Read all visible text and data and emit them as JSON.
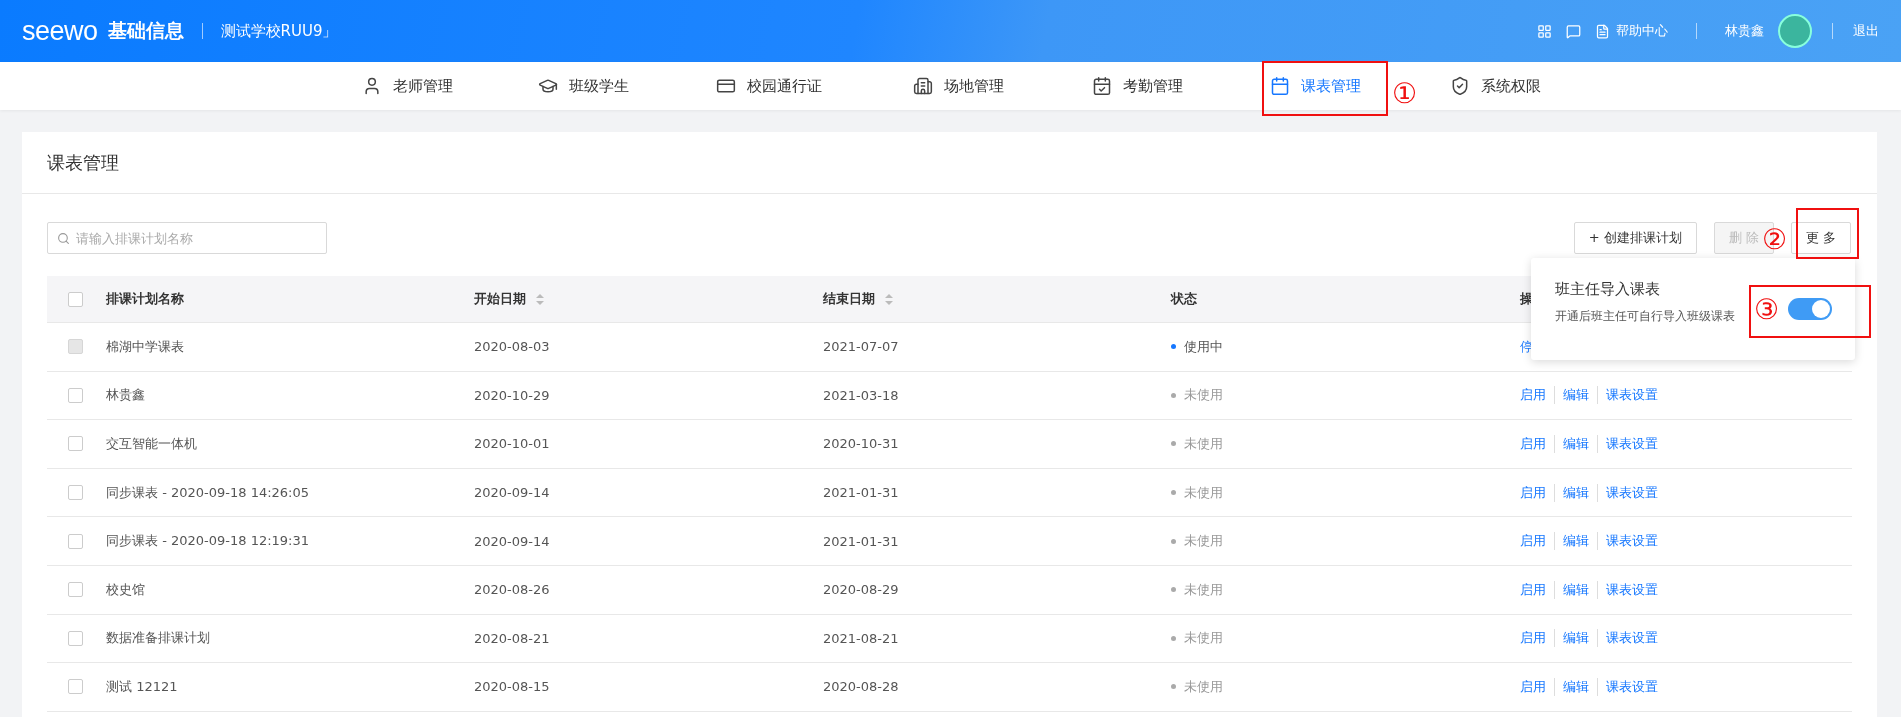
{
  "header": {
    "logo": "seewo",
    "app_name": "基础信息",
    "school": "测试学校RUU9」",
    "help": "帮助中心",
    "user": "林贵鑫",
    "logout": "退出"
  },
  "nav": [
    {
      "label": "老师管理",
      "selected": false
    },
    {
      "label": "班级学生",
      "selected": false
    },
    {
      "label": "校园通行证",
      "selected": false
    },
    {
      "label": "场地管理",
      "selected": false
    },
    {
      "label": "考勤管理",
      "selected": false
    },
    {
      "label": "课表管理",
      "selected": true
    },
    {
      "label": "系统权限",
      "selected": false
    }
  ],
  "card": {
    "title": "课表管理",
    "search": {
      "placeholder": "请输入排课计划名称"
    },
    "buttons": [
      {
        "label": "+ 创建排课计划",
        "disabled": false
      },
      {
        "label": "删 除",
        "disabled": true
      },
      {
        "label": "更 多",
        "disabled": false
      }
    ]
  },
  "table": {
    "select_all": {
      "checked": false
    },
    "columns": [
      {
        "label": "排课计划名称",
        "sortable": false
      },
      {
        "label": "开始日期",
        "sortable": true
      },
      {
        "label": "结束日期",
        "sortable": true
      },
      {
        "label": "状态",
        "sortable": false
      },
      {
        "label": "操",
        "sortable": false
      }
    ],
    "rows": [
      {
        "checkbox_disabled": true,
        "name": "棉湖中学课表",
        "start": "2020-08-03",
        "end": "2021-07-07",
        "status": {
          "text": "使用中",
          "kind": "active"
        },
        "actions": [
          "停"
        ]
      },
      {
        "checkbox_disabled": false,
        "name": "林贵鑫",
        "start": "2020-10-29",
        "end": "2021-03-18",
        "status": {
          "text": "未使用",
          "kind": "inactive"
        },
        "actions": [
          "启用",
          "编辑",
          "课表设置"
        ]
      },
      {
        "checkbox_disabled": false,
        "name": "交互智能一体机",
        "start": "2020-10-01",
        "end": "2020-10-31",
        "status": {
          "text": "未使用",
          "kind": "inactive"
        },
        "actions": [
          "启用",
          "编辑",
          "课表设置"
        ]
      },
      {
        "checkbox_disabled": false,
        "name": "同步课表 - 2020-09-18 14:26:05",
        "start": "2020-09-14",
        "end": "2021-01-31",
        "status": {
          "text": "未使用",
          "kind": "inactive"
        },
        "actions": [
          "启用",
          "编辑",
          "课表设置"
        ]
      },
      {
        "checkbox_disabled": false,
        "name": "同步课表 - 2020-09-18 12:19:31",
        "start": "2020-09-14",
        "end": "2021-01-31",
        "status": {
          "text": "未使用",
          "kind": "inactive"
        },
        "actions": [
          "启用",
          "编辑",
          "课表设置"
        ]
      },
      {
        "checkbox_disabled": false,
        "name": "校史馆",
        "start": "2020-08-26",
        "end": "2020-08-29",
        "status": {
          "text": "未使用",
          "kind": "inactive"
        },
        "actions": [
          "启用",
          "编辑",
          "课表设置"
        ]
      },
      {
        "checkbox_disabled": false,
        "name": "数据准备排课计划",
        "start": "2020-08-21",
        "end": "2021-08-21",
        "status": {
          "text": "未使用",
          "kind": "inactive"
        },
        "actions": [
          "启用",
          "编辑",
          "课表设置"
        ]
      },
      {
        "checkbox_disabled": false,
        "name": "测试 12121",
        "start": "2020-08-15",
        "end": "2020-08-28",
        "status": {
          "text": "未使用",
          "kind": "inactive"
        },
        "actions": [
          "启用",
          "编辑",
          "课表设置"
        ]
      }
    ]
  },
  "popup": {
    "title": "班主任导入课表",
    "description": "开通后班主任可自行导入班级课表",
    "on": true
  },
  "annotations": [
    {
      "label": "①"
    },
    {
      "label": "②"
    },
    {
      "label": "③"
    }
  ]
}
